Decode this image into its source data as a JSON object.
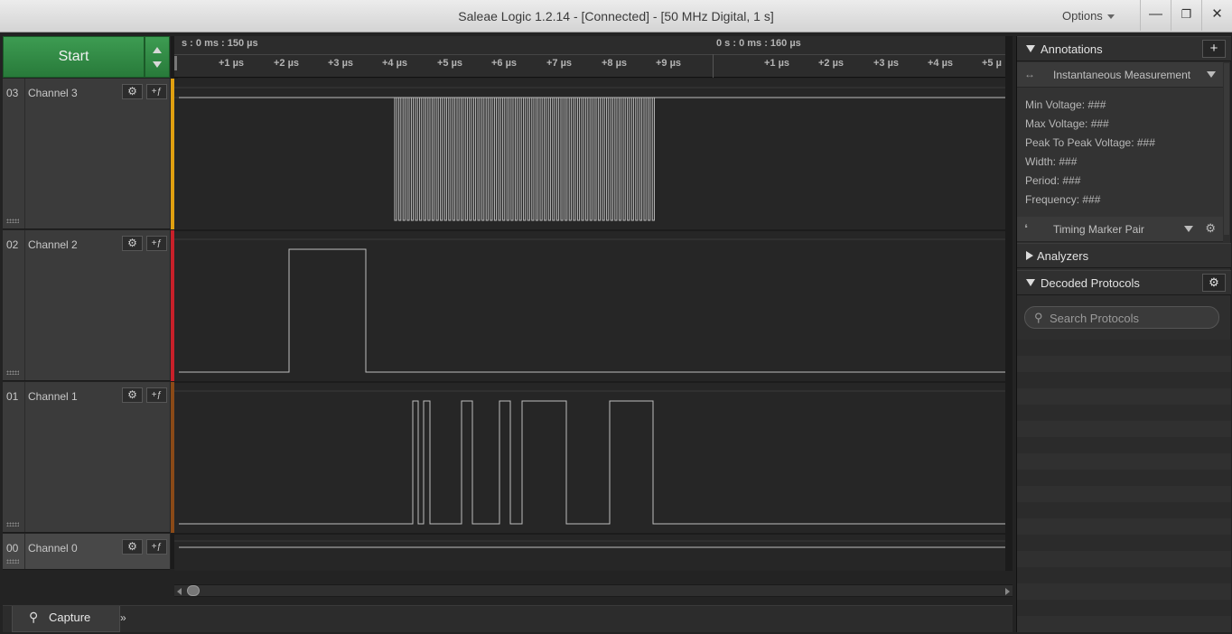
{
  "window": {
    "title": "Saleae Logic 1.2.14 - [Connected] - [50 MHz Digital, 1 s]",
    "options_label": "Options",
    "minimize_glyph": "—",
    "maximize_glyph": "❐",
    "close_glyph": "✕"
  },
  "start_button": {
    "label": "Start"
  },
  "timeline": {
    "marker_left": "s : 0 ms : 150 µs",
    "marker_right": "0 s : 0 ms : 160 µs",
    "ticks_left": [
      "+1 µs",
      "+2 µs",
      "+3 µs",
      "+4 µs",
      "+5 µs",
      "+6 µs",
      "+7 µs",
      "+8 µs",
      "+9 µs"
    ],
    "ticks_right": [
      "+1 µs",
      "+2 µs",
      "+3 µs",
      "+4 µs",
      "+5 µ"
    ]
  },
  "channels": [
    {
      "num": "03",
      "name": "Channel 3",
      "color": "#e0a010"
    },
    {
      "num": "02",
      "name": "Channel 2",
      "color": "#c8202a"
    },
    {
      "num": "01",
      "name": "Channel 1",
      "color": "#8a4a18"
    },
    {
      "num": "00",
      "name": "Channel 0",
      "color": "#2a2a2a"
    }
  ],
  "channel_buttons": {
    "gear_glyph": "⚙",
    "trigger_glyph": "+ƒ"
  },
  "bottom": {
    "capture_tab": "Capture",
    "more_glyph": "»"
  },
  "annotations": {
    "header": "Annotations",
    "add_glyph": "+",
    "instantaneous": {
      "icon_glyph": "↔",
      "label": "Instantaneous Measurement"
    },
    "measurements": [
      "Min Voltage: ###",
      "Max Voltage: ###",
      "Peak To Peak Voltage: ###",
      "Width: ###",
      "Period: ###",
      "Frequency: ###"
    ],
    "timing_pair": {
      "icon_glyph": "❛",
      "label": "Timing Marker Pair",
      "gear_glyph": "⚙"
    }
  },
  "analyzers": {
    "header": "Analyzers"
  },
  "decoded": {
    "header": "Decoded Protocols",
    "gear_glyph": "⚙",
    "search_placeholder": "Search Protocols",
    "search_icon": "⚲"
  }
}
